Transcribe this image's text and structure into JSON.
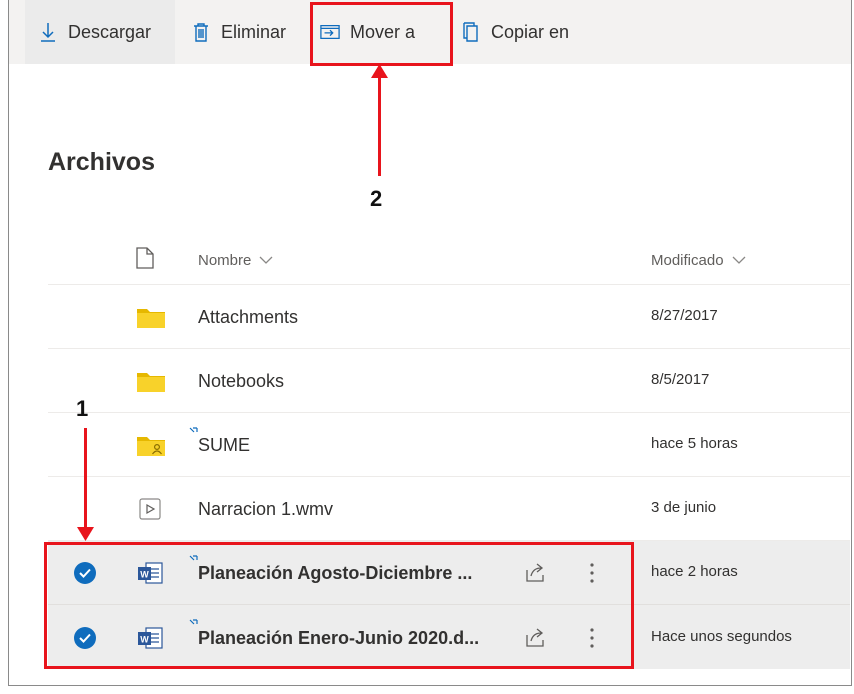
{
  "toolbar": {
    "download": "Descargar",
    "delete": "Eliminar",
    "move": "Mover a",
    "copy": "Copiar en"
  },
  "section_title": "Archivos",
  "columns": {
    "name": "Nombre",
    "modified": "Modificado"
  },
  "files": [
    {
      "name": "Attachments",
      "modified": "8/27/2017",
      "icon": "folder-icon",
      "selected": false
    },
    {
      "name": "Notebooks",
      "modified": "8/5/2017",
      "icon": "folder-icon",
      "selected": false
    },
    {
      "name": "SUME",
      "modified": "hace 5 horas",
      "icon": "shared-folder-icon",
      "selected": false
    },
    {
      "name": "Narracion 1.wmv",
      "modified": "3 de junio",
      "icon": "video-icon",
      "selected": false
    },
    {
      "name": "Planeación Agosto-Diciembre ...",
      "modified": "hace 2 horas",
      "icon": "word-icon",
      "selected": true
    },
    {
      "name": "Planeación Enero-Junio 2020.d...",
      "modified": "Hace unos segundos",
      "icon": "word-icon",
      "selected": true
    }
  ],
  "annotations": {
    "step1": "1",
    "step2": "2"
  },
  "colors": {
    "annotation_red": "#e8141c",
    "selection_blue": "#0f6cbd",
    "folder_yellow": "#f8d22a",
    "word_blue": "#2b579a"
  }
}
